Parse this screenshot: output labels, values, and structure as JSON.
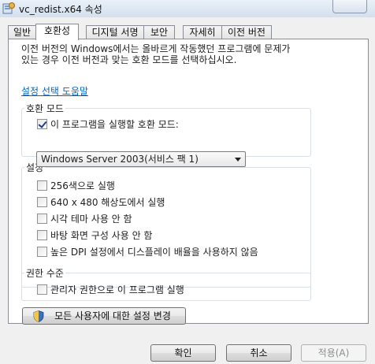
{
  "window": {
    "title": "vc_redist.x64 속성"
  },
  "tabs": [
    {
      "label": "일반"
    },
    {
      "label": "호환성"
    },
    {
      "label": "디지털 서명"
    },
    {
      "label": "보안"
    },
    {
      "label": "자세히"
    },
    {
      "label": "이전 버전"
    }
  ],
  "compat": {
    "description_line1": "이전 버전의 Windows에서는 올바르게 작동했던 프로그램에 문제가",
    "description_line2": "있는 경우 이전 버전과 맞는 호환 모드를 선택하십시오.",
    "help_link": "설정 선택 도움말",
    "mode_group": {
      "label": "호환 모드",
      "checkbox_label": "이 프로그램을 실행할 호환 모드:",
      "checked": true,
      "selected_os": "Windows Server 2003(서비스 팩 1)"
    },
    "settings_group": {
      "label": "설정",
      "options": [
        {
          "label": "256색으로 실행",
          "checked": false
        },
        {
          "label": "640 x 480 해상도에서 실행",
          "checked": false
        },
        {
          "label": "시각 테마 사용 안 함",
          "checked": false
        },
        {
          "label": "바탕 화면 구성 사용 안 함",
          "checked": false
        },
        {
          "label": "높은 DPI 설정에서 디스플레이 배율을 사용하지 않음",
          "checked": false
        }
      ]
    },
    "privilege_group": {
      "label": "권한 수준",
      "checkbox_label": "관리자 권한으로 이 프로그램 실행",
      "checked": false
    },
    "all_users_button": "모든 사용자에 대한 설정 변경"
  },
  "footer": {
    "ok": "확인",
    "cancel": "취소",
    "apply": "적용(A)"
  },
  "icons": {
    "title": "program-properties-icon",
    "uac": "uac-shield-icon"
  }
}
